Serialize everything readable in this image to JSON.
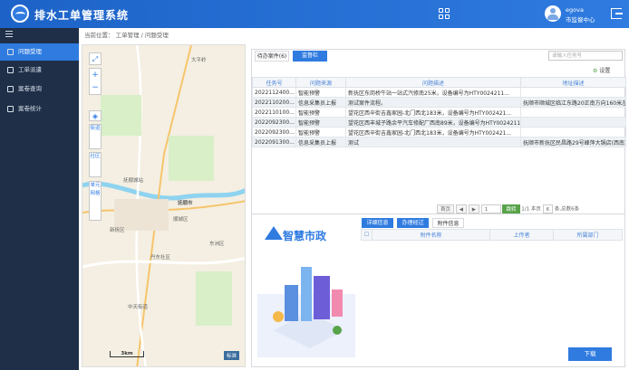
{
  "header": {
    "title": "排水工单管理系统",
    "user_name": "egova",
    "user_org": "市监督中心"
  },
  "sidebar": {
    "items": [
      {
        "label": "问题受理"
      },
      {
        "label": "工单派遣"
      },
      {
        "label": "案卷查询"
      },
      {
        "label": "案卷统计"
      }
    ]
  },
  "breadcrumb": "当前位置： 工单管理 / 问题受理",
  "map": {
    "controls": [
      "街道",
      "社区",
      "单元网格"
    ],
    "scale": "3km",
    "badge": "标准",
    "labels": [
      "大平岭",
      "抚顺城站",
      "新抚区",
      "顺城区",
      "抚顺市",
      "丹东社区",
      "中天街道",
      "东洲区"
    ]
  },
  "list": {
    "tabs": [
      "待办案件(6)",
      "监督栏"
    ],
    "search_placeholder": "请输入任务号",
    "settings_label": "设置",
    "columns": [
      "任务号",
      "问题来源",
      "问题描述",
      "地址描述"
    ],
    "rows": [
      [
        "2022112400...",
        "智能预警",
        "新抚区东岗桥牛站一站式汽修南25米，设备编号为HTY0024211...",
        ""
      ],
      [
        "2022110200...",
        "信息采集员上报",
        "测试案件流程。",
        "抚顺市顺城区临江东路20正南方向160米左右"
      ],
      [
        "2022110100...",
        "智能预警",
        "望花区西辛街吉鑫家园-北门西北183米，设备编号为HTY002421...",
        ""
      ],
      [
        "2022092300...",
        "智能预警",
        "望花区西丰城子路余平汽车修配厂西南89米，设备编号为HTY0024211...",
        ""
      ],
      [
        "2022092300...",
        "智能预警",
        "望花区西辛街吉鑫家园-北门西北183米，设备编号为HTY002421...",
        ""
      ],
      [
        "2022091300...",
        "信息采集员上报",
        "测试",
        "抚顺市新抚区民昌路29号峰萍大锅店(西南)"
      ]
    ],
    "pager": {
      "first": "首页",
      "page": "1",
      "jump": "跳转",
      "info": "1/1 本页",
      "count": "6",
      "suffix": "条,总数6条"
    }
  },
  "detail": {
    "tabs": [
      "详细信息",
      "办理经过",
      "附件信息"
    ],
    "columns": [
      "附件名称",
      "上传者",
      "所属部门"
    ],
    "download_label": "下载",
    "illustration_text": "智慧市政"
  }
}
